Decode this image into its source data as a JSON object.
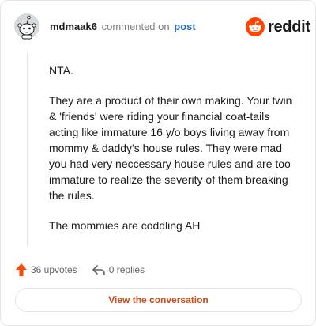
{
  "header": {
    "username": "mdmaak6",
    "commented_on": "commented on",
    "post_link": "post",
    "brand": "reddit"
  },
  "comment": {
    "paragraphs": [
      "NTA.",
      "They are a product of their own making. Your twin & 'friends' were riding your financial coat-tails acting like immature 16 y/o boys living away from mommy & daddy's house rules. They were mad you had very neccessary house rules and are too immature to realize the severity of them breaking the rules.",
      "The mommies are coddling AH"
    ]
  },
  "actions": {
    "upvotes": "36 upvotes",
    "replies": "0 replies"
  },
  "footer": {
    "view_conversation": "View the conversation"
  },
  "colors": {
    "accent_orange": "#ff4500",
    "button_text": "#cf4a14",
    "link_blue": "#2b6ec2"
  },
  "icons": {
    "avatar": "snoo-avatar-icon",
    "brand": "reddit-logo-icon",
    "upvote": "upvote-arrow-icon",
    "reply": "reply-arrow-icon"
  }
}
